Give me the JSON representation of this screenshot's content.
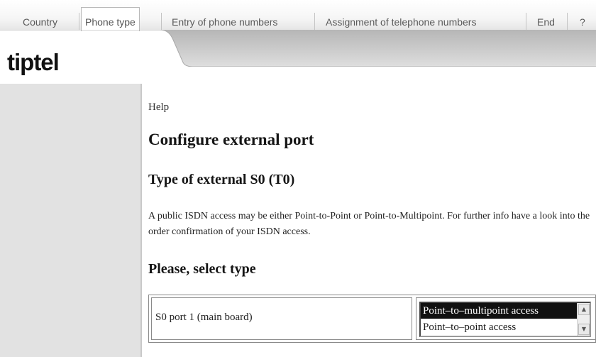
{
  "tabs": [
    {
      "label": "Country",
      "active": false
    },
    {
      "label": "Phone type",
      "active": true
    },
    {
      "label": "Entry of phone numbers",
      "active": false
    },
    {
      "label": "Assignment of telephone numbers",
      "active": false
    },
    {
      "label": "End",
      "active": false
    },
    {
      "label": "?",
      "active": false
    }
  ],
  "brand": {
    "logo_text": "tiptel"
  },
  "main": {
    "help_label": "Help",
    "title": "Configure external port",
    "section_title": "Type of external S0 (T0)",
    "description": "A public ISDN access may be either Point-to-Point or Point-to-Multipoint. For further info have a look into the order confirmation of your ISDN access.",
    "select_heading": "Please, select type",
    "ports": [
      {
        "label": "S0 port 1 (main board)",
        "options": [
          "Point–to–multipoint access",
          "Point–to–point access"
        ],
        "selected": "Point–to–multipoint access"
      }
    ]
  },
  "icons": {
    "scroll_up": "scroll-up-arrow-icon",
    "scroll_down": "scroll-down-arrow-icon"
  },
  "colors": {
    "sidebar": "#e2e2e2",
    "band": "#dcdcdc",
    "selected_option": "#111111"
  }
}
